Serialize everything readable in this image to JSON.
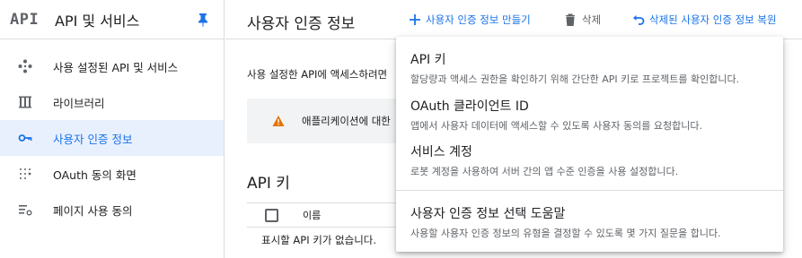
{
  "sidebar": {
    "logo": "API",
    "title": "API 및 서비스",
    "items": [
      {
        "label": "사용 설정된 API 및 서비스",
        "icon": "diamond-nodes-icon"
      },
      {
        "label": "라이브러리",
        "icon": "library-icon"
      },
      {
        "label": "사용자 인증 정보",
        "icon": "key-icon",
        "active": true
      },
      {
        "label": "OAuth 동의 화면",
        "icon": "dots-grid-icon"
      },
      {
        "label": "페이지 사용 동의",
        "icon": "settings-list-icon"
      }
    ]
  },
  "header": {
    "title": "사용자 인증 정보",
    "create_label": "사용자 인증 정보 만들기",
    "delete_label": "삭제",
    "restore_label": "삭제된 사용자 인증 정보 복원"
  },
  "main": {
    "description": "사용 설정한 API에 액세스하려면",
    "warning_text": "애플리케이션에 대한",
    "section_title": "API 키",
    "table": {
      "columns": [
        "이름"
      ],
      "empty_text": "표시할 API 키가 없습니다."
    }
  },
  "menu": {
    "items": [
      {
        "title": "API 키",
        "description": "할당량과 액세스 권한을 확인하기 위해 간단한 API 키로 프로젝트를 확인합니다."
      },
      {
        "title": "OAuth 클라이언트 ID",
        "description": "앱에서 사용자 데이터에 액세스할 수 있도록 사용자 동의를 요청합니다."
      },
      {
        "title": "서비스 계정",
        "description": "로봇 계정을 사용하여 서버 간의 앱 수준 인증을 사용 설정합니다."
      },
      {
        "title": "사용자 인증 정보 선택 도움말",
        "description": "사용할 사용자 인증 정보의 유형을 결정할 수 있도록 몇 가지 질문을 합니다."
      }
    ]
  },
  "colors": {
    "accent": "#1a73e8",
    "active_bg": "#e8f0fe",
    "warning": "#e37400"
  }
}
